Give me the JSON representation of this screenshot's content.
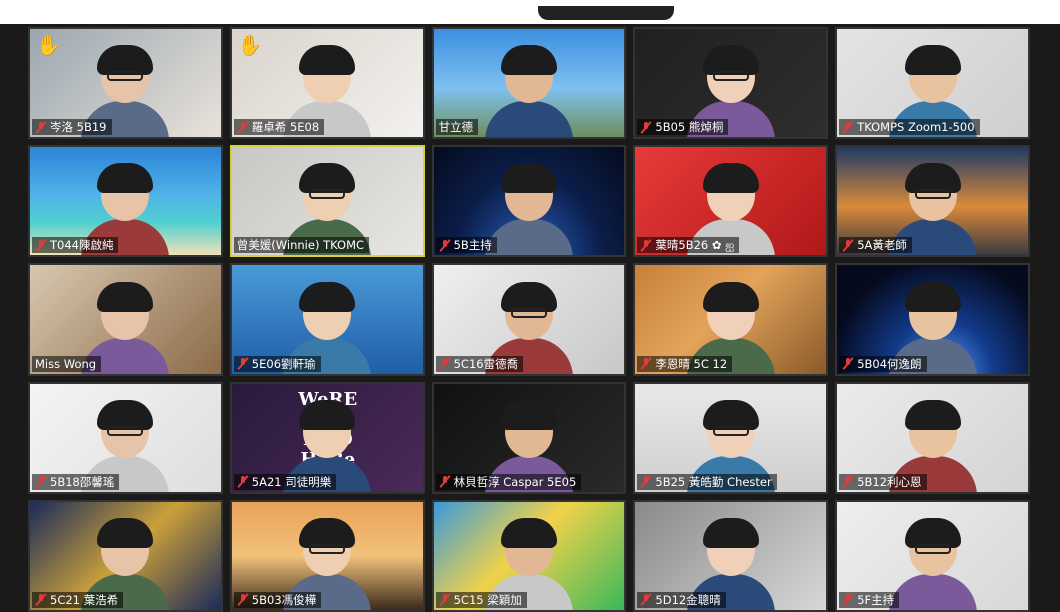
{
  "tiles": [
    {
      "name": "岑洛 5B19",
      "muted": true,
      "hand": true,
      "bg": "linear-gradient(135deg,#9aa7b0,#e9e2da)"
    },
    {
      "name": "羅卓希 5E08",
      "muted": true,
      "hand": true,
      "bg": "linear-gradient(135deg,#d9d4cc,#f3f1ee)"
    },
    {
      "name": "甘立德",
      "muted": false,
      "hand": false,
      "bg": "linear-gradient(180deg,#3b8fe0 0%,#7fc0f0 55%,#6d8f5b 100%)"
    },
    {
      "name": "5B05 熊焯桐",
      "muted": true,
      "hand": false,
      "bg": "linear-gradient(135deg,#202020,#2e2e2e)"
    },
    {
      "name": "TKOMPS Zoom1-500",
      "muted": true,
      "hand": false,
      "bg": "linear-gradient(135deg,#e4e4e4,#cfcfcf)"
    },
    {
      "name": "T044陳啟純",
      "muted": true,
      "hand": false,
      "bg": "linear-gradient(180deg,#2d83d8 0%,#4fb4e8 45%,#50d0d0 70%,#f0e2b8 100%)"
    },
    {
      "name": "曾美媛(Winnie) TKOMC",
      "muted": false,
      "hand": false,
      "active": true,
      "bg": "linear-gradient(135deg,#c9c7c3,#e7e6e2)"
    },
    {
      "name": "5B主持",
      "muted": true,
      "hand": false,
      "bg": "radial-gradient(ellipse at 50% 110%,#2a66c8 0%,#0b1d49 55%,#050b1e 100%)"
    },
    {
      "name": "葉晴5B26 ✿ ஐ",
      "muted": true,
      "hand": false,
      "bg": "linear-gradient(135deg,#e83a3a,#b01818)"
    },
    {
      "name": "5A黃老師",
      "muted": true,
      "hand": false,
      "bg": "linear-gradient(180deg,#1f3a66 0%,#d98a3a 55%,#3b3a40 100%)"
    },
    {
      "name": "Miss Wong",
      "muted": false,
      "hand": false,
      "bg": "linear-gradient(135deg,#d8c8b0,#8b6a48)"
    },
    {
      "name": "5E06劉軒瑜",
      "muted": true,
      "hand": false,
      "bg": "linear-gradient(180deg,#4a9ad8,#1f5ea8)"
    },
    {
      "name": "5C16雷德喬",
      "muted": true,
      "hand": false,
      "bg": "linear-gradient(135deg,#efefef,#c8c8c8)"
    },
    {
      "name": "李恩晴 5C 12",
      "muted": true,
      "hand": false,
      "bg": "linear-gradient(135deg,#c7803a,#e3a35a 45%,#8a5a2a)"
    },
    {
      "name": "5B04何逸朗",
      "muted": true,
      "hand": false,
      "bg": "radial-gradient(ellipse at 55% 100%,#5aa0ff 0%,#123a8a 35%,#050a1e 75%)"
    },
    {
      "name": "5B18邵馨瑤",
      "muted": true,
      "hand": false,
      "bg": "linear-gradient(135deg,#f4f4f4,#dedede)"
    },
    {
      "name": "5A21 司徒明樂",
      "muted": true,
      "hand": false,
      "bg": "linear-gradient(135deg,#2a1a3a,#4a2a5a)",
      "sign": "WeRE ALL MAD HeRe"
    },
    {
      "name": "林貝哲淳 Caspar 5E05",
      "muted": true,
      "hand": false,
      "bg": "linear-gradient(135deg,#111,#2a2a2a)"
    },
    {
      "name": "5B25 黃皓勤 Chester",
      "muted": true,
      "hand": false,
      "bg": "linear-gradient(180deg,#e8e8e8,#cfcfcf)"
    },
    {
      "name": "5B12利心恩",
      "muted": true,
      "hand": false,
      "bg": "linear-gradient(135deg,#ebebeb,#d4d4d4)"
    },
    {
      "name": "5C21 葉浩希",
      "muted": true,
      "hand": false,
      "bg": "linear-gradient(135deg,#1a2a5a,#c9a03a 50%,#1a2a5a)"
    },
    {
      "name": "5B03馮俊樺",
      "muted": true,
      "hand": false,
      "bg": "linear-gradient(180deg,#e8a25a 0%,#f2c27a 50%,#3a2a1a 100%)"
    },
    {
      "name": "5C15 梁穎加",
      "muted": true,
      "hand": false,
      "bg": "linear-gradient(135deg,#3a9ad8,#f2d24a 45%,#3ab85a)"
    },
    {
      "name": "5D12金聰晴",
      "muted": true,
      "hand": false,
      "bg": "linear-gradient(135deg,#8a8a8a,#d8d8d8)"
    },
    {
      "name": "5F主持",
      "muted": true,
      "hand": false,
      "bg": "linear-gradient(135deg,#eeeeee,#d8d8d8)"
    }
  ]
}
